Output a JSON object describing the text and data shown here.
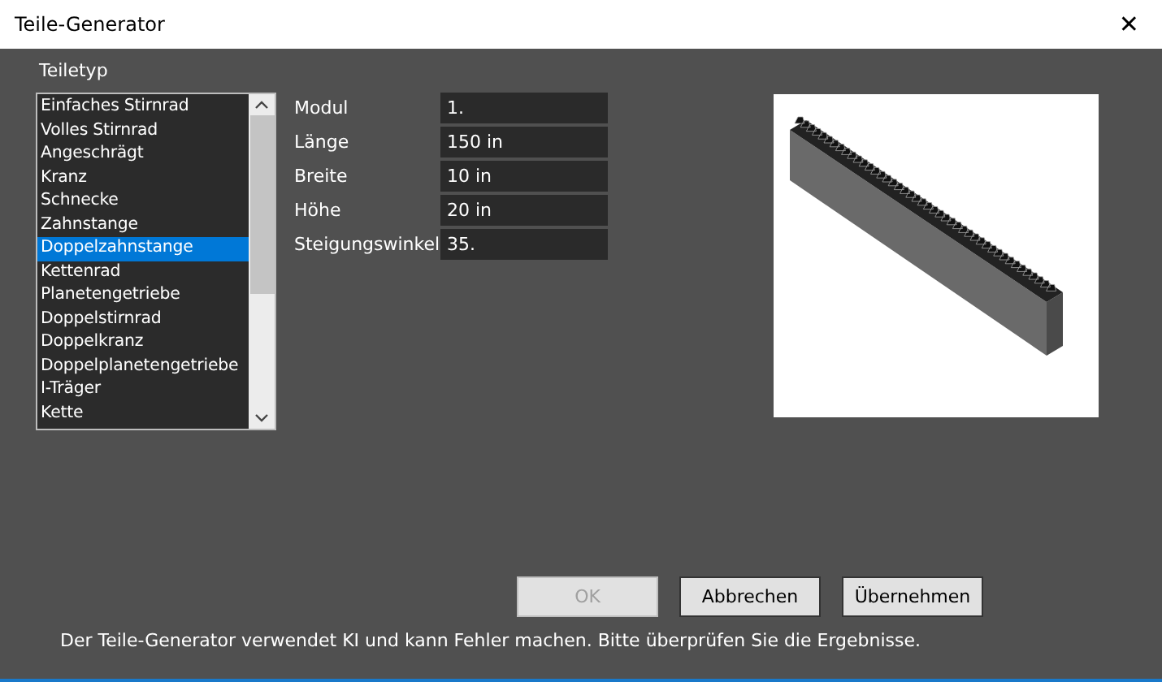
{
  "window": {
    "title": "Teile-Generator",
    "close": "✕"
  },
  "part_type": {
    "label": "Teiletyp",
    "items": [
      {
        "label": "Einfaches Stirnrad",
        "selected": false
      },
      {
        "label": "Volles Stirnrad",
        "selected": false
      },
      {
        "label": "Angeschrägt",
        "selected": false
      },
      {
        "label": "Kranz",
        "selected": false
      },
      {
        "label": "Schnecke",
        "selected": false
      },
      {
        "label": "Zahnstange",
        "selected": false
      },
      {
        "label": "Doppelzahnstange",
        "selected": true
      },
      {
        "label": "Kettenrad",
        "selected": false
      },
      {
        "label": "Planetengetriebe",
        "selected": false
      },
      {
        "label": "Doppelstirnrad",
        "selected": false
      },
      {
        "label": "Doppelkranz",
        "selected": false
      },
      {
        "label": "Doppelplanetengetriebe",
        "selected": false
      },
      {
        "label": "I-Träger",
        "selected": false
      },
      {
        "label": "Kette",
        "selected": false
      }
    ]
  },
  "parameters": [
    {
      "label": "Modul",
      "value": "1."
    },
    {
      "label": "Länge",
      "value": "150 in"
    },
    {
      "label": "Breite",
      "value": "10 in"
    },
    {
      "label": "Höhe",
      "value": "20 in"
    },
    {
      "label": "Steigungswinkel",
      "value": "35."
    }
  ],
  "buttons": [
    {
      "label": "OK",
      "disabled": true
    },
    {
      "label": "Abbrechen",
      "disabled": false
    },
    {
      "label": "Übernehmen",
      "disabled": false
    }
  ],
  "footer": "Der Teile-Generator verwendet KI und kann Fehler machen. Bitte überprüfen Sie die Ergebnisse."
}
